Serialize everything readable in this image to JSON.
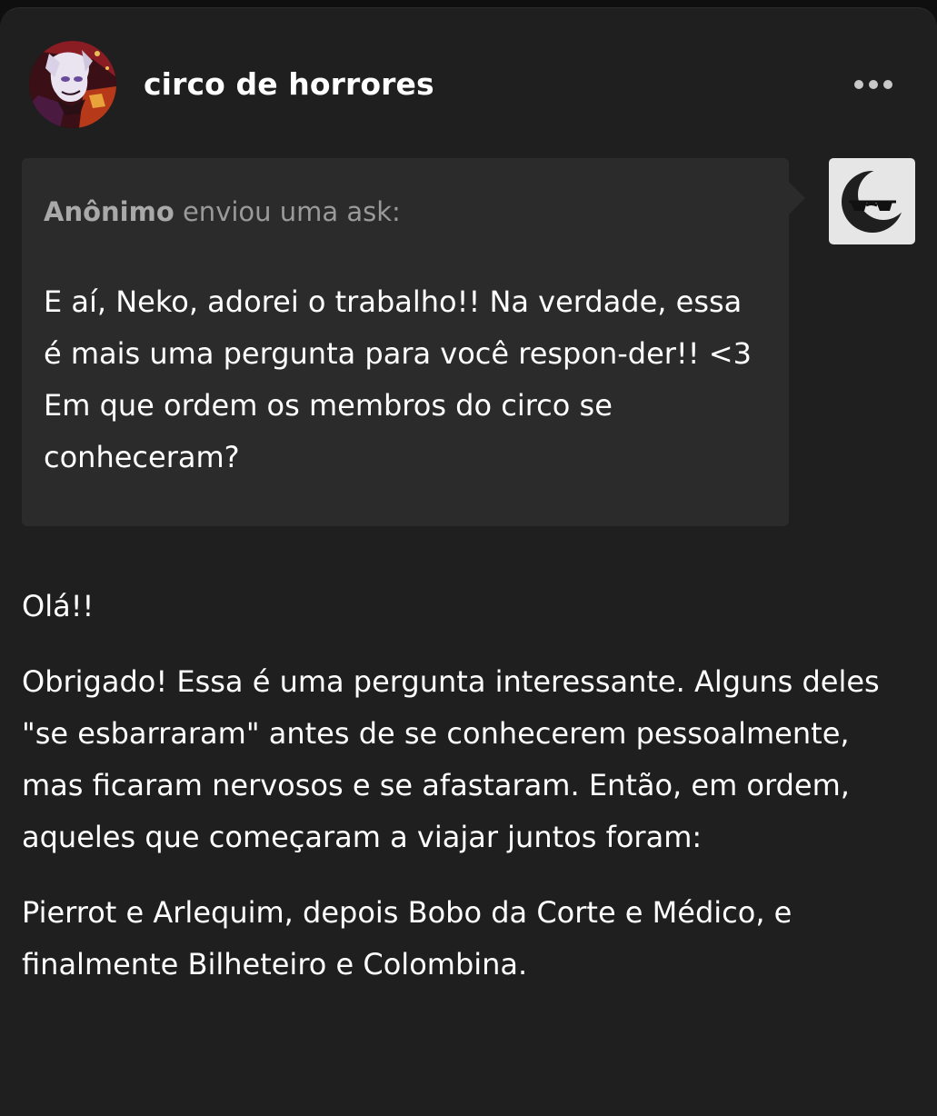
{
  "post": {
    "blog_name": "circo de horrores",
    "more_icon": "more-horizontal-icon"
  },
  "ask": {
    "asker": "Anônimo",
    "action": "enviou uma ask:",
    "question": "E aí, Neko, adorei o trabalho!! Na verdade, essa é mais uma pergunta para você respon-der!! <3 Em que ordem os membros do circo se conheceram?",
    "avatar_icon": "anonymous-sunglasses-avatar-icon"
  },
  "answer": {
    "paragraphs": [
      "Olá!!",
      "Obrigado! Essa é uma pergunta interessante. Alguns deles \"se esbarraram\" antes de se conhecerem pessoalmente, mas ficaram nervosos e se afastaram. Então, em ordem, aqueles que começaram a viajar juntos foram:",
      "Pierrot e Arlequim, depois Bobo da Corte e Médico, e finalmente Bilheteiro e Colombina."
    ]
  },
  "colors": {
    "page_background": "#1f1f1f",
    "ask_background": "#2b2b2b",
    "text": "#ffffff",
    "muted_text": "#9a9a9a"
  }
}
